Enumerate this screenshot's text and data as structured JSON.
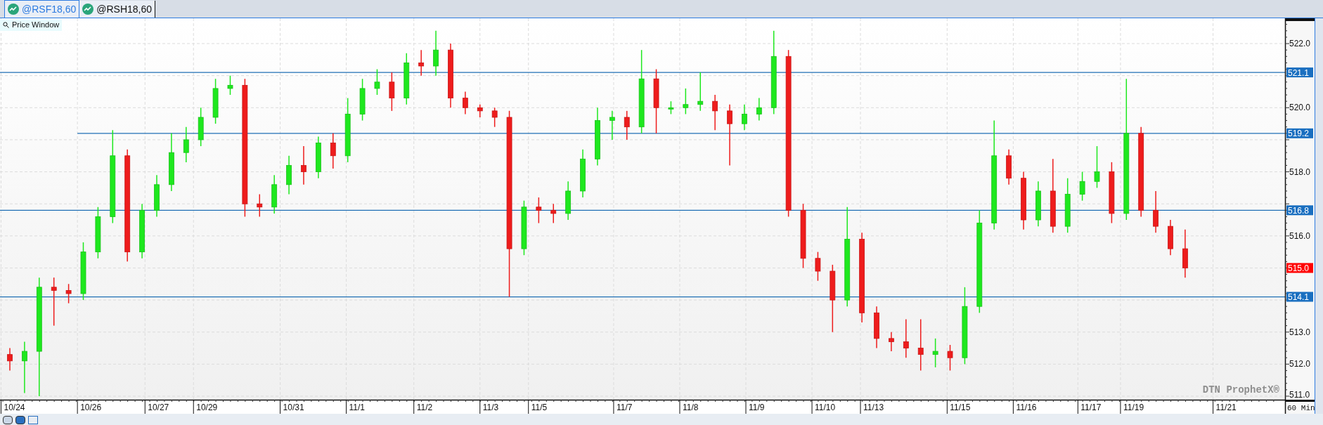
{
  "tabs": [
    {
      "label": "@RSF18,60",
      "selected": true
    },
    {
      "label": "@RSH18,60",
      "selected": false
    }
  ],
  "chart": {
    "title": "Price Window",
    "branding": "DTN ProphetX®",
    "interval": "60 Min",
    "price_labels": [
      "522.0",
      "520.0",
      "518.0",
      "516.0",
      "513.0",
      "512.0",
      "511.0"
    ],
    "date_labels": [
      "10/24",
      "10/26",
      "10/27",
      "10/29",
      "10/31",
      "11/1",
      "11/2",
      "11/3",
      "11/5",
      "11/7",
      "11/8",
      "11/9",
      "11/10",
      "11/13",
      "11/15",
      "11/16",
      "11/17",
      "11/19",
      "11/21"
    ],
    "level_tags": [
      {
        "label": "521.1"
      },
      {
        "label": "519.2"
      },
      {
        "label": "516.8"
      },
      {
        "label": "514.1"
      }
    ],
    "last_price_tag": "515.0"
  }
}
